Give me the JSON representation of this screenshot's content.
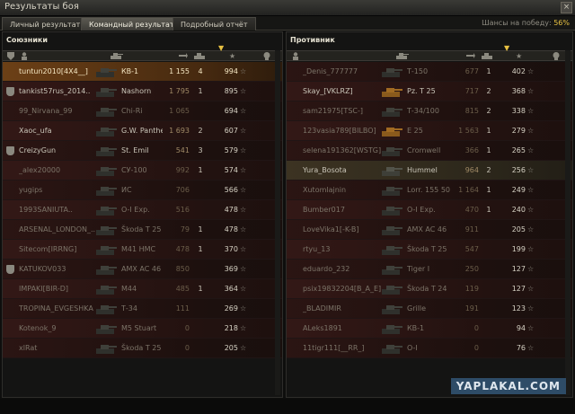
{
  "window": {
    "title": "Результаты боя",
    "close_glyph": "×"
  },
  "tabs": [
    {
      "label": "Личный результат",
      "active": false
    },
    {
      "label": "Командный результат",
      "active": true
    },
    {
      "label": "Подробный отчёт",
      "active": false
    }
  ],
  "win_chance": {
    "label": "Шансы на победу:",
    "value": "56%"
  },
  "allies": {
    "title": "Союзники",
    "columns": {
      "squad_icon": "squad-icon",
      "player_icon": "player-icon",
      "tank_icon": "tank-icon",
      "damage_icon": "damage-icon",
      "frags_icon": "frags-icon",
      "sort_marker": "▼",
      "xp_icon": "★",
      "status_icon": "skull-icon"
    },
    "rows": [
      {
        "player": "tuntun2010[4X4__]",
        "tank": "КВ-1",
        "damage": "1 155",
        "frags": "4",
        "xp": "994",
        "star": "☆",
        "me": true
      },
      {
        "player": "tankist57rus_2014..",
        "tank": "Nashorn",
        "damage": "1 795",
        "frags": "1",
        "xp": "895",
        "star": "☆",
        "badge": true
      },
      {
        "player": "99_Nirvana_99",
        "tank": "Chi-Ri",
        "damage": "1 065",
        "frags": "",
        "xp": "694",
        "star": "☆",
        "dead": true
      },
      {
        "player": "Xaoc_ufa",
        "tank": "G.W. Panther",
        "damage": "1 693",
        "frags": "2",
        "xp": "607",
        "star": "☆"
      },
      {
        "player": "CreizyGun",
        "tank": "St. Emil",
        "damage": "541",
        "frags": "3",
        "xp": "579",
        "star": "☆",
        "badge": true
      },
      {
        "player": "_alex20000",
        "tank": "СУ-100",
        "damage": "992",
        "frags": "1",
        "xp": "574",
        "star": "☆",
        "dead": true
      },
      {
        "player": "yugips",
        "tank": "ИС",
        "damage": "706",
        "frags": "",
        "xp": "566",
        "star": "☆",
        "dead": true
      },
      {
        "player": "1993SANIUTA..",
        "tank": "O-I Exp.",
        "damage": "516",
        "frags": "",
        "xp": "478",
        "star": "☆",
        "dead": true
      },
      {
        "player": "ARSENAL_LONDON_..",
        "tank": "Škoda T 25",
        "damage": "79",
        "frags": "1",
        "xp": "478",
        "star": "☆",
        "dead": true
      },
      {
        "player": "Sitecom[IRRNG]",
        "tank": "M41 HMC",
        "damage": "478",
        "frags": "1",
        "xp": "370",
        "star": "☆",
        "dead": true
      },
      {
        "player": "KATUKOV033",
        "tank": "AMX AC 46",
        "damage": "850",
        "frags": "",
        "xp": "369",
        "star": "☆",
        "badge": true,
        "dead": true
      },
      {
        "player": "IMPAKI[BIR-D]",
        "tank": "M44",
        "damage": "485",
        "frags": "1",
        "xp": "364",
        "star": "☆",
        "dead": true
      },
      {
        "player": "TROPINA_EVGESHKA",
        "tank": "Т-34",
        "damage": "111",
        "frags": "",
        "xp": "269",
        "star": "☆",
        "dead": true
      },
      {
        "player": "Kotenok_9",
        "tank": "M5 Stuart",
        "damage": "0",
        "frags": "",
        "xp": "218",
        "star": "☆",
        "dead": true
      },
      {
        "player": "xlRat",
        "tank": "Škoda T 25",
        "damage": "0",
        "frags": "",
        "xp": "205",
        "star": "☆",
        "dead": true
      }
    ]
  },
  "enemies": {
    "title": "Противник",
    "columns": {
      "player_icon": "player-icon",
      "tank_icon": "tank-icon",
      "damage_icon": "damage-icon",
      "frags_icon": "frags-icon",
      "sort_marker": "▼",
      "xp_icon": "★",
      "status_icon": "skull-icon"
    },
    "rows": [
      {
        "player": "_Denis_777777",
        "tank": "Т-150",
        "damage": "677",
        "frags": "1",
        "xp": "402",
        "star": "☆",
        "dead": true
      },
      {
        "player": "Skay_[VKLRZ]",
        "tank": "Pz. T 25",
        "damage": "717",
        "frags": "2",
        "xp": "368",
        "star": "☆"
      },
      {
        "player": "sam21975[TSC-]",
        "tank": "Т-34/100",
        "damage": "815",
        "frags": "2",
        "xp": "338",
        "star": "☆",
        "dead": true
      },
      {
        "player": "123vasia789[BILBO]",
        "tank": "E 25",
        "damage": "1 563",
        "frags": "1",
        "xp": "279",
        "star": "☆",
        "dead": true
      },
      {
        "player": "selena191362[WSTG]",
        "tank": "Cromwell",
        "damage": "366",
        "frags": "1",
        "xp": "265",
        "star": "☆",
        "dead": true
      },
      {
        "player": "Yura_Bosota",
        "tank": "Hummel",
        "damage": "964",
        "frags": "2",
        "xp": "256",
        "star": "☆",
        "hl": true
      },
      {
        "player": "Xutomlajnin",
        "tank": "Lorr. 155 50",
        "damage": "1 164",
        "frags": "1",
        "xp": "249",
        "star": "☆",
        "dead": true
      },
      {
        "player": "Bumber017",
        "tank": "O-I Exp.",
        "damage": "470",
        "frags": "1",
        "xp": "240",
        "star": "☆",
        "dead": true
      },
      {
        "player": "LoveVika1[-K-B]",
        "tank": "AMX AC 46",
        "damage": "911",
        "frags": "",
        "xp": "205",
        "star": "☆",
        "dead": true
      },
      {
        "player": "rtyu_13",
        "tank": "Škoda T 25",
        "damage": "547",
        "frags": "",
        "xp": "199",
        "star": "☆",
        "dead": true
      },
      {
        "player": "eduardo_232",
        "tank": "Tiger I",
        "damage": "250",
        "frags": "",
        "xp": "127",
        "star": "☆",
        "dead": true
      },
      {
        "player": "psix19832204[B_A_E]",
        "tank": "Škoda T 24",
        "damage": "119",
        "frags": "",
        "xp": "127",
        "star": "☆",
        "dead": true
      },
      {
        "player": "_BLADIMIR",
        "tank": "Grille",
        "damage": "191",
        "frags": "",
        "xp": "123",
        "star": "☆",
        "dead": true
      },
      {
        "player": "ALeks1891",
        "tank": "КВ-1",
        "damage": "0",
        "frags": "",
        "xp": "94",
        "star": "☆",
        "dead": true
      },
      {
        "player": "11tigr111[__RR_]",
        "tank": "O-I",
        "damage": "0",
        "frags": "",
        "xp": "76",
        "star": "☆",
        "dead": true
      }
    ]
  },
  "watermark": "YAPLAKAL.COM",
  "colors": {
    "accent": "#e7c142",
    "own_row": "#6c4016",
    "row_bg": "#2b1513",
    "panel_bg": "#141413",
    "watermark_bg": "#2e4c67"
  }
}
